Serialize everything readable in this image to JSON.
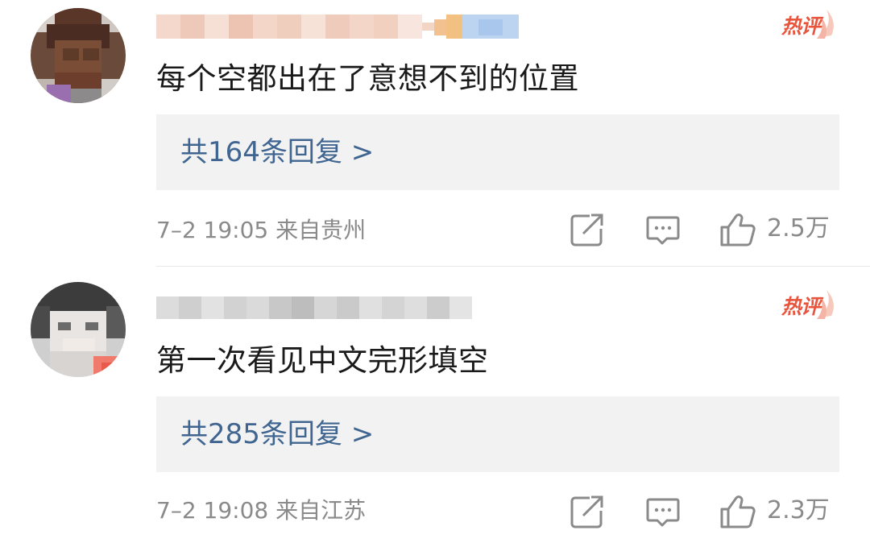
{
  "comments": [
    {
      "hot_label": "热评",
      "text": "每个空都出在了意想不到的位置",
      "reply_label": "共164条回复 >",
      "date": "7–2 19:05",
      "location": "来自贵州",
      "likes": "2.5万",
      "username_blurred": true
    },
    {
      "hot_label": "热评",
      "text": "第一次看见中文完形填空",
      "reply_label": "共285条回复 >",
      "date": "7–2 19:08",
      "location": "来自江苏",
      "likes": "2.3万",
      "username_blurred": true
    }
  ],
  "icons": {
    "share": "share-icon",
    "comment": "comment-icon",
    "like": "thumbs-up-icon"
  },
  "colors": {
    "hot": "#e8543c",
    "reply_link": "#3f6590",
    "meta": "#8a8a8a",
    "reply_bg": "#f2f2f2"
  }
}
